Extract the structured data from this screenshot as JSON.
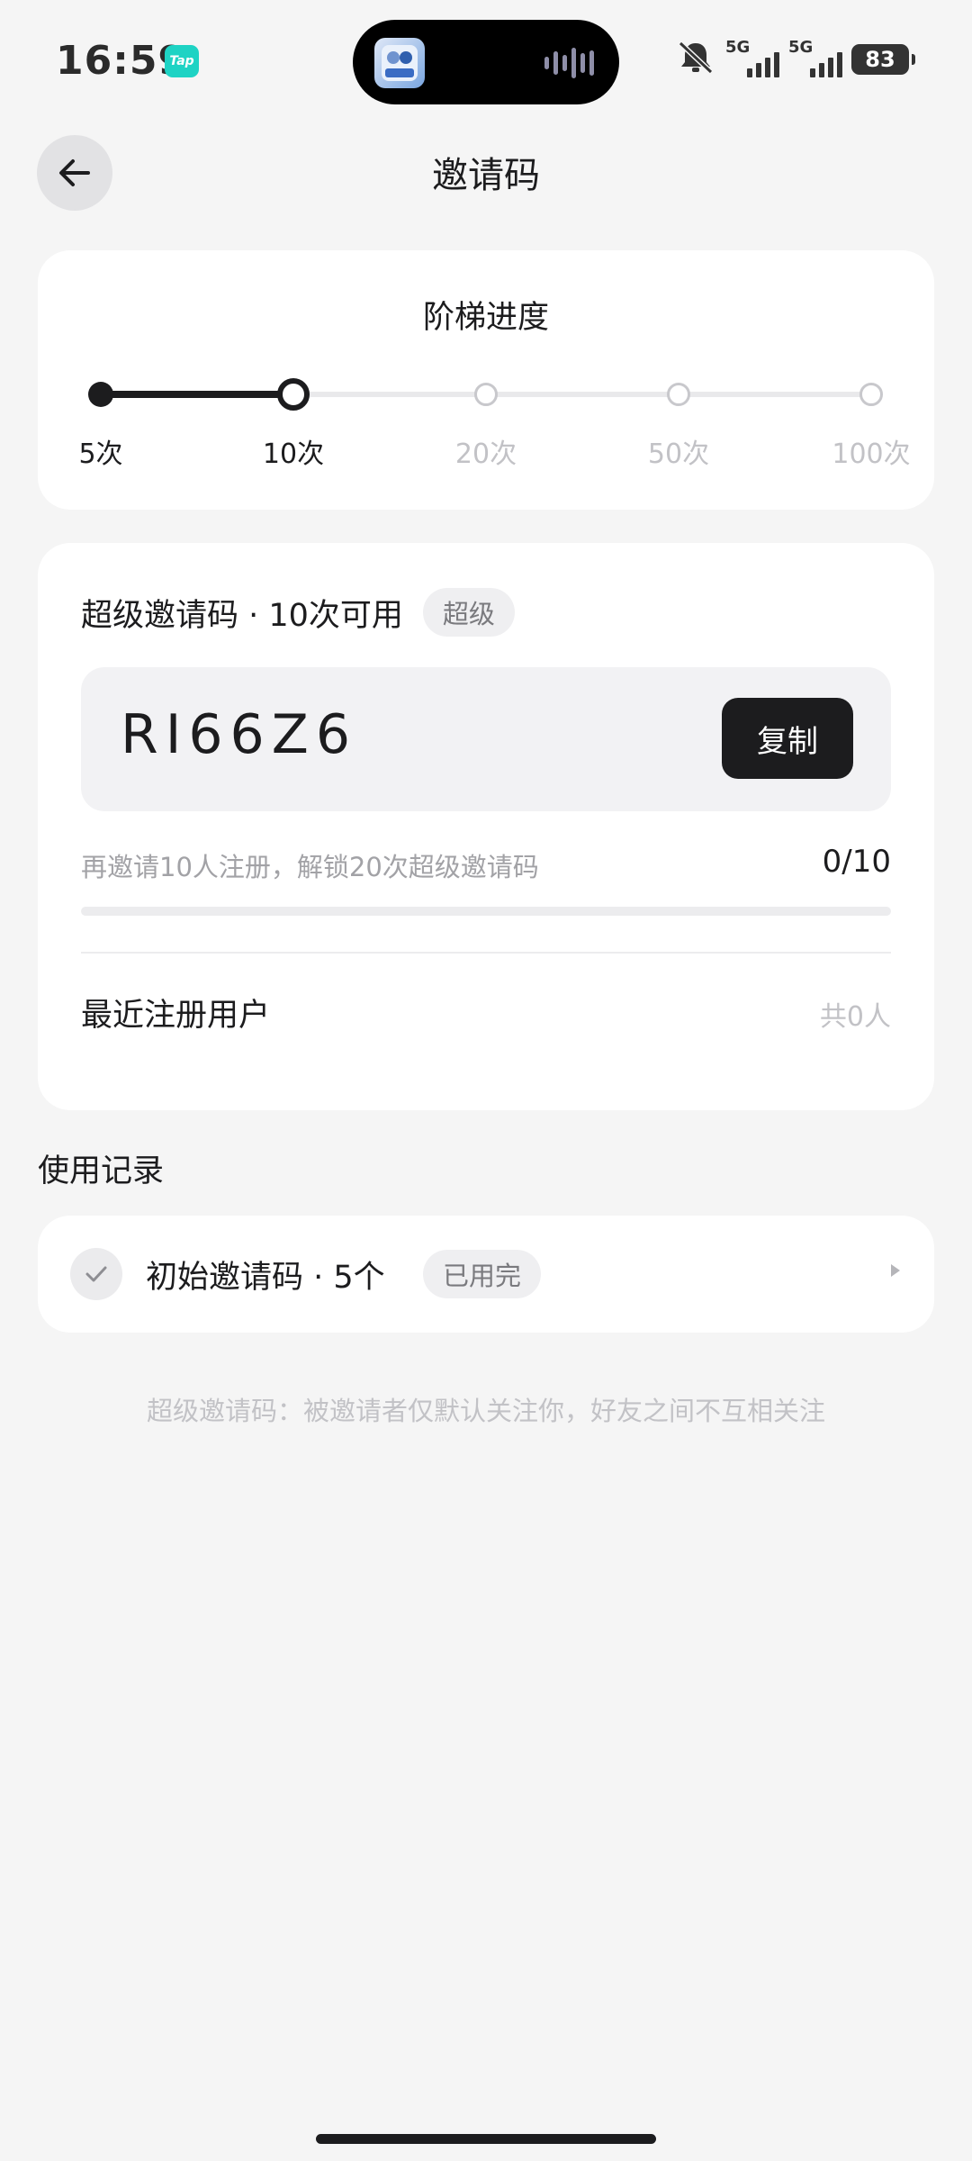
{
  "status_bar": {
    "time": "16:59",
    "tap_badge": "Tap",
    "network_1": "5G",
    "network_2": "5G",
    "battery": "83",
    "icons": [
      "tap-app-icon",
      "game-app-icon",
      "voice-wave-icon",
      "mute-bell-icon",
      "signal-5g-icon",
      "signal-5g-icon",
      "battery-icon"
    ]
  },
  "header": {
    "title": "邀请码",
    "back_icon": "arrow-left-icon"
  },
  "ladder": {
    "title": "阶梯进度",
    "current_index": 1,
    "steps": [
      {
        "label": "5次",
        "state": "done"
      },
      {
        "label": "10次",
        "state": "current"
      },
      {
        "label": "20次",
        "state": "future"
      },
      {
        "label": "50次",
        "state": "future"
      },
      {
        "label": "100次",
        "state": "future"
      }
    ]
  },
  "code_card": {
    "heading": "超级邀请码 · 10次可用",
    "tag": "超级",
    "code": "RI66Z6",
    "copy_label": "复制",
    "progress_text": "再邀请10人注册，解锁20次超级邀请码",
    "progress_count": "0/10",
    "progress_value": 0,
    "recent_title": "最近注册用户",
    "recent_count": "共0人"
  },
  "records": {
    "section_title": "使用记录",
    "items": [
      {
        "text": "初始邀请码 · 5个",
        "tag": "已用完",
        "icon": "check-icon"
      }
    ]
  },
  "footnote": "超级邀请码：被邀请者仅默认关注你，好友之间不互相关注",
  "colors": {
    "background": "#f5f5f5",
    "card": "#ffffff",
    "primary": "#1c1c1e",
    "muted": "#c2c2c6",
    "accent_tap": "#1ed3c4"
  }
}
